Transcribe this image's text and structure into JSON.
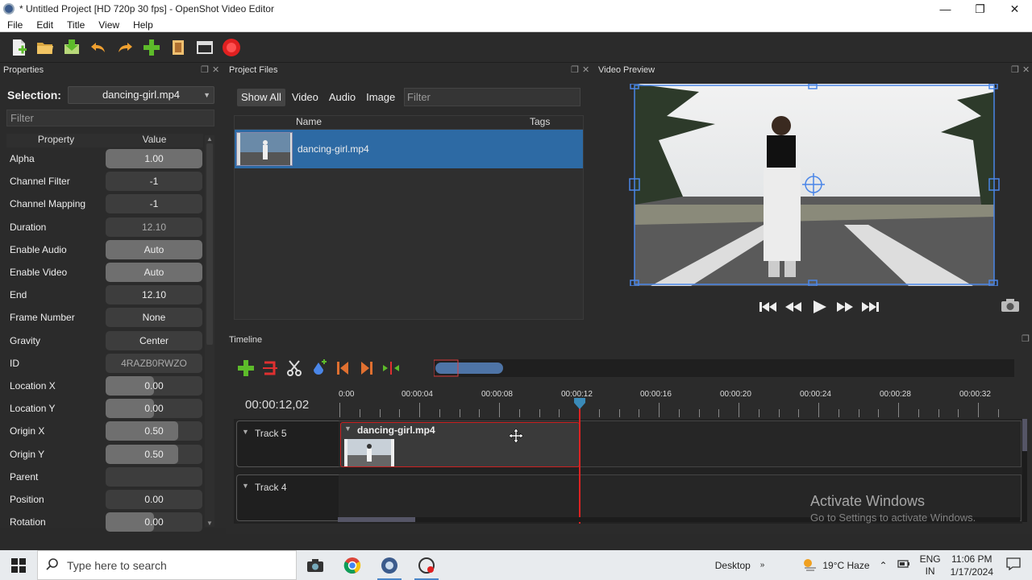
{
  "window": {
    "title": "* Untitled Project [HD 720p 30 fps] - OpenShot Video Editor"
  },
  "menu": [
    "File",
    "Edit",
    "Title",
    "View",
    "Help"
  ],
  "properties_panel": {
    "title": "Properties",
    "selection_label": "Selection:",
    "selection_value": "dancing-girl.mp4",
    "filter_placeholder": "Filter",
    "col_property": "Property",
    "col_value": "Value",
    "rows": [
      {
        "name": "Alpha",
        "value": "1.00",
        "fill": 1.0
      },
      {
        "name": "Channel Filter",
        "value": "-1",
        "fill": 0
      },
      {
        "name": "Channel Mapping",
        "value": "-1",
        "fill": 0
      },
      {
        "name": "Duration",
        "value": "12.10",
        "fill": 0
      },
      {
        "name": "Enable Audio",
        "value": "Auto",
        "fill": 1.0
      },
      {
        "name": "Enable Video",
        "value": "Auto",
        "fill": 1.0
      },
      {
        "name": "End",
        "value": "12.10",
        "fill": 0
      },
      {
        "name": "Frame Number",
        "value": "None",
        "fill": 0
      },
      {
        "name": "Gravity",
        "value": "Center",
        "fill": 0
      },
      {
        "name": "ID",
        "value": "4RAZB0RWZO",
        "fill": 0
      },
      {
        "name": "Location X",
        "value": "0.00",
        "fill": 0.5
      },
      {
        "name": "Location Y",
        "value": "0.00",
        "fill": 0.5
      },
      {
        "name": "Origin X",
        "value": "0.50",
        "fill": 0.75
      },
      {
        "name": "Origin Y",
        "value": "0.50",
        "fill": 0.75
      },
      {
        "name": "Parent",
        "value": "",
        "fill": 0
      },
      {
        "name": "Position",
        "value": "0.00",
        "fill": 0
      },
      {
        "name": "Rotation",
        "value": "0.00",
        "fill": 0.5
      }
    ]
  },
  "project_files": {
    "title": "Project Files",
    "tabs": [
      "Show All",
      "Video",
      "Audio",
      "Image"
    ],
    "filter_placeholder": "Filter",
    "col_name": "Name",
    "col_tags": "Tags",
    "files": [
      {
        "name": "dancing-girl.mp4"
      }
    ]
  },
  "video_preview": {
    "title": "Video Preview"
  },
  "timeline": {
    "title": "Timeline",
    "current_time": "00:00:12,02",
    "ticks": [
      "0:00",
      "00:00:04",
      "00:00:08",
      "00:00:12",
      "00:00:16",
      "00:00:20",
      "00:00:24",
      "00:00:28",
      "00:00:32"
    ],
    "tracks": [
      {
        "name": "Track 5",
        "clip": "dancing-girl.mp4"
      },
      {
        "name": "Track 4",
        "clip": ""
      }
    ]
  },
  "watermark": {
    "line1": "Activate Windows",
    "line2": "Go to Settings to activate Windows."
  },
  "taskbar": {
    "search_placeholder": "Type here to search",
    "desktop_label": "Desktop",
    "weather": "19°C Haze",
    "lang_1": "ENG",
    "lang_2": "IN",
    "time": "11:06 PM",
    "date": "1/17/2024"
  },
  "colors": {
    "accent": "#2d6aa4",
    "playhead": "#dd2222",
    "record": "#e02020",
    "add": "#5dbb2a"
  }
}
